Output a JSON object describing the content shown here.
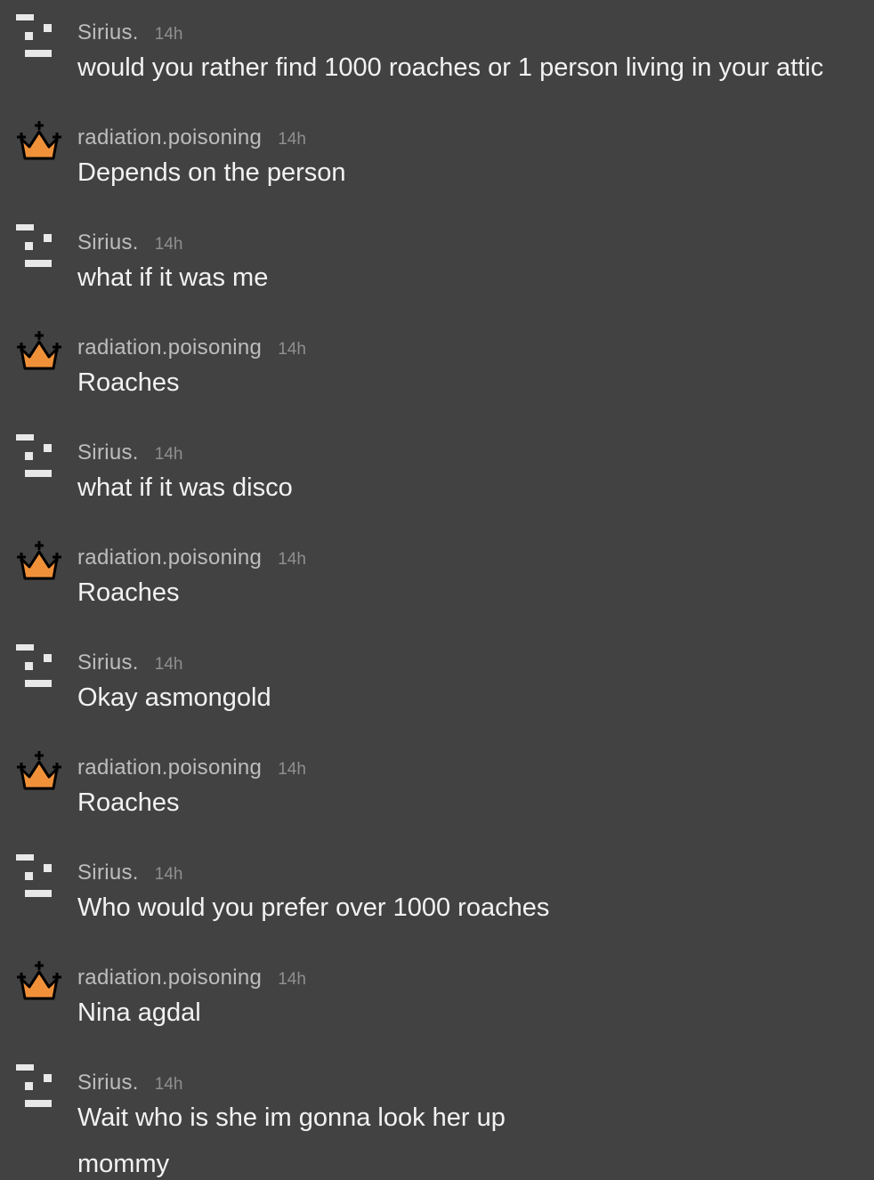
{
  "messages": [
    {
      "username": "Sirius.",
      "time": "14h",
      "text": "would you rather find 1000 roaches or 1 person living in your attic",
      "avatar": "bars-icon"
    },
    {
      "username": "radiation.poisoning",
      "time": "14h",
      "text": "Depends on the person",
      "avatar": "crown-icon"
    },
    {
      "username": "Sirius.",
      "time": "14h",
      "text": "what if it was me",
      "avatar": "bars-icon"
    },
    {
      "username": "radiation.poisoning",
      "time": "14h",
      "text": "Roaches",
      "avatar": "crown-icon"
    },
    {
      "username": "Sirius.",
      "time": "14h",
      "text": "what if it was disco",
      "avatar": "bars-icon"
    },
    {
      "username": "radiation.poisoning",
      "time": "14h",
      "text": "Roaches",
      "avatar": "crown-icon"
    },
    {
      "username": "Sirius.",
      "time": "14h",
      "text": "Okay asmongold",
      "avatar": "bars-icon"
    },
    {
      "username": "radiation.poisoning",
      "time": "14h",
      "text": "Roaches",
      "avatar": "crown-icon"
    },
    {
      "username": "Sirius.",
      "time": "14h",
      "text": "Who would you prefer over 1000 roaches",
      "avatar": "bars-icon"
    },
    {
      "username": "radiation.poisoning",
      "time": "14h",
      "text": "Nina agdal",
      "avatar": "crown-icon"
    },
    {
      "username": "Sirius.",
      "time": "14h",
      "text": "Wait who is she im gonna look her up",
      "avatar": "bars-icon"
    }
  ],
  "trailing_text": "mommy",
  "colors": {
    "background": "#424242",
    "username": "#bdbdbd",
    "timestamp": "#8f8f8f",
    "message_text": "#f2f2f2",
    "crown_fill": "#f0913a",
    "bars_icon": "#e8e8e8"
  }
}
